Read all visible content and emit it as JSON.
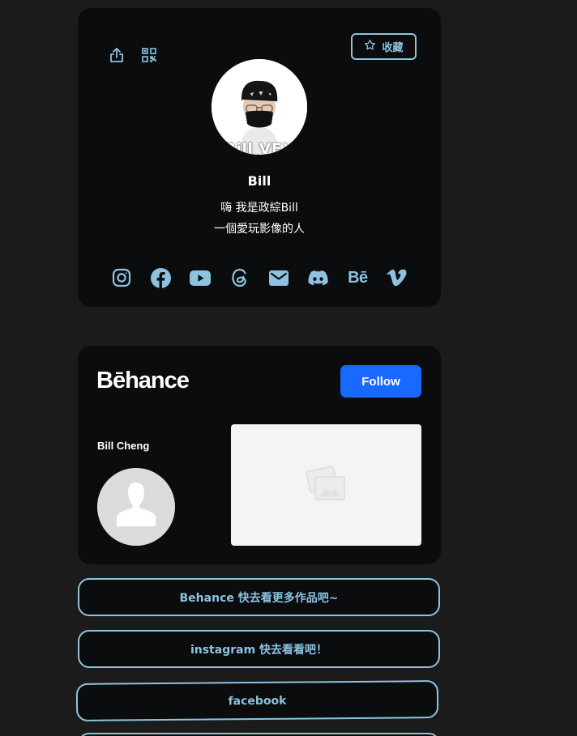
{
  "profile": {
    "favorite_label": "收藏",
    "avatar_text": "Bill VFX",
    "name": "Bill",
    "bio_line1": "嗨 我是政綜Bill",
    "bio_line2": "一個愛玩影像的人",
    "socials": [
      {
        "icon": "instagram-icon"
      },
      {
        "icon": "facebook-icon"
      },
      {
        "icon": "youtube-icon"
      },
      {
        "icon": "threads-icon"
      },
      {
        "icon": "email-icon"
      },
      {
        "icon": "discord-icon"
      },
      {
        "icon": "behance-icon",
        "glyph": "Bē"
      },
      {
        "icon": "vimeo-icon"
      }
    ]
  },
  "behance": {
    "logo": "Bēhance",
    "follow_label": "Follow",
    "username": "Bill Cheng"
  },
  "links": [
    {
      "label": "Behance 快去看更多作品吧~"
    },
    {
      "label": "instagram 快去看看吧！"
    },
    {
      "label": "facebook"
    },
    {
      "label": ""
    }
  ],
  "colors": {
    "background": "#1b1b1b",
    "card": "#0b0c0d",
    "accent": "#8ec3e0",
    "behance_blue": "#1769ff"
  }
}
